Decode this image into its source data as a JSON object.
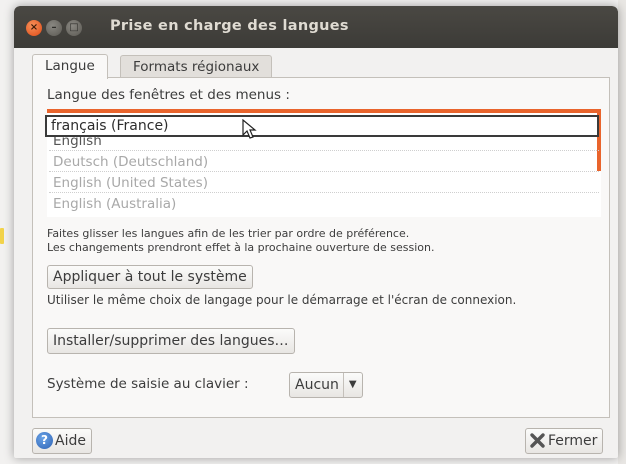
{
  "window": {
    "title": "Prise en charge des langues",
    "controls": [
      "close-icon",
      "minimize-icon",
      "maximize-icon"
    ]
  },
  "tabs": [
    {
      "label": "Langue",
      "active": true
    },
    {
      "label": "Formats régionaux",
      "active": false
    }
  ],
  "language_section": {
    "label": "Langue des fenêtres et des menus :",
    "dragged_item": "français (France)",
    "items": [
      "English",
      "Deutsch (Deutschland)",
      "English (United States)",
      "English (Australia)"
    ],
    "hint_line1": "Faites glisser les langues afin de les trier par ordre de préférence.",
    "hint_line2": "Les changements prendront effet à la prochaine ouverture de session."
  },
  "apply_button": {
    "label": "Appliquer à tout le système"
  },
  "apply_description": "Utiliser le même choix de langage pour le démarrage et l'écran de connexion.",
  "install_button": {
    "label": "Installer/supprimer des langues…"
  },
  "keyboard": {
    "label": "Système de saisie au clavier :",
    "value": "Aucun"
  },
  "footer": {
    "help_label": "Aide",
    "close_label": "Fermer"
  },
  "colors": {
    "accent": "#e9642c",
    "titlebar": "#3c3b37",
    "window_bg": "#f2f1f0"
  }
}
